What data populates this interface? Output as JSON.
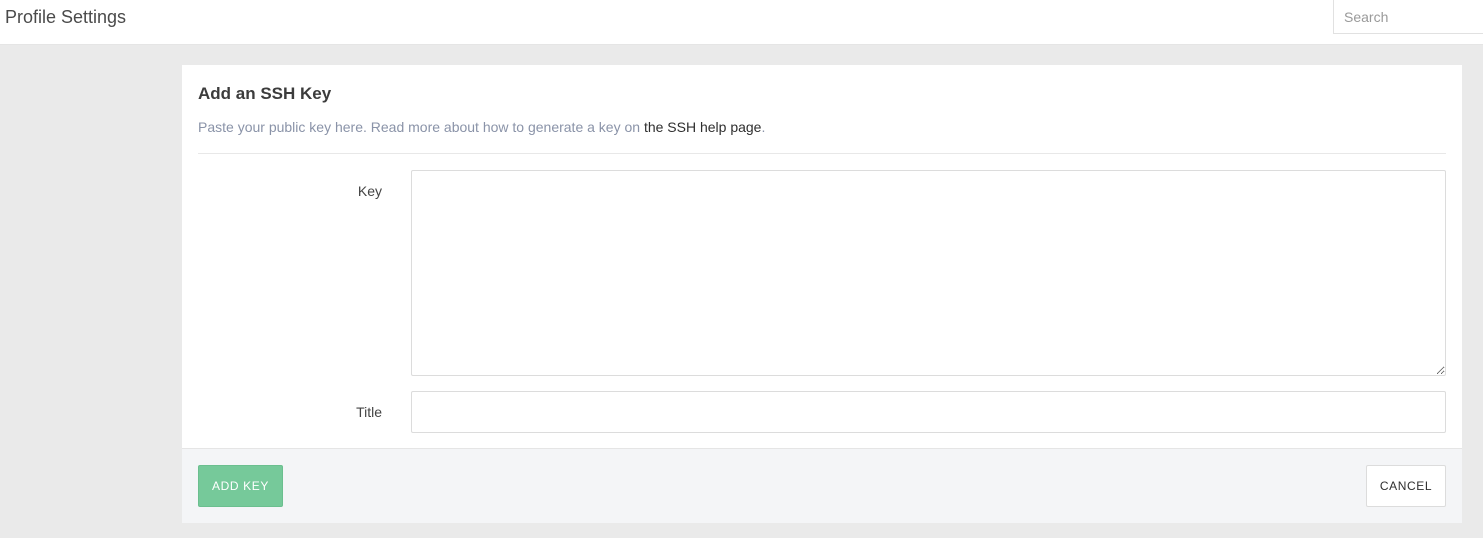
{
  "header": {
    "title": "Profile Settings",
    "search_placeholder": "Search"
  },
  "panel": {
    "heading": "Add an SSH Key",
    "help_text": "Paste your public key here. Read more about how to generate a key on ",
    "help_link": "the SSH help page",
    "help_suffix": ".",
    "fields": {
      "key_label": "Key",
      "key_value": "",
      "title_label": "Title",
      "title_value": ""
    }
  },
  "footer": {
    "add_label": "ADD KEY",
    "cancel_label": "CANCEL"
  },
  "colors": {
    "primary_button": "#76c99a",
    "background": "#eaeaea",
    "muted_text": "#8a93a8"
  }
}
